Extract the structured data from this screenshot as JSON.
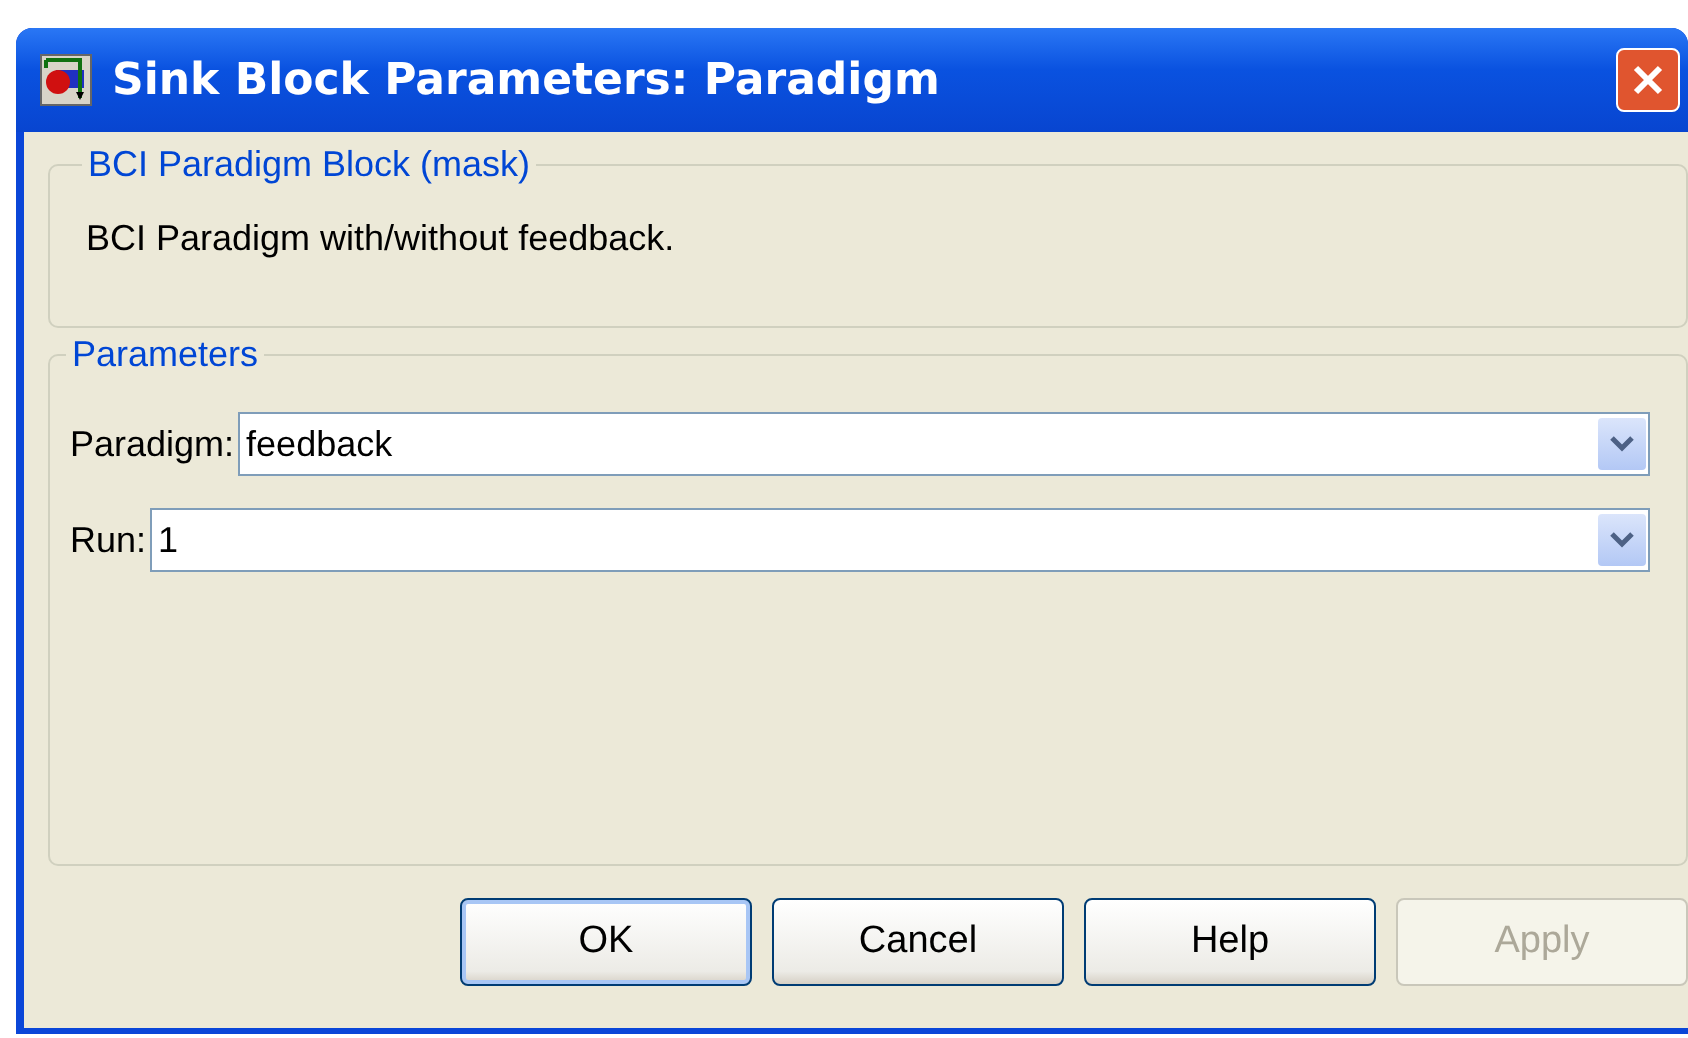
{
  "window": {
    "title": "Sink Block Parameters: Paradigm"
  },
  "description_group": {
    "legend": "BCI Paradigm Block (mask)",
    "text": "BCI Paradigm with/without feedback."
  },
  "parameters_group": {
    "legend": "Parameters",
    "fields": [
      {
        "label": "Paradigm:",
        "value": "feedback"
      },
      {
        "label": "Run:",
        "value": "1"
      }
    ]
  },
  "buttons": [
    {
      "label": "OK",
      "disabled": false,
      "default": true
    },
    {
      "label": "Cancel",
      "disabled": false,
      "default": false
    },
    {
      "label": "Help",
      "disabled": false,
      "default": false
    },
    {
      "label": "Apply",
      "disabled": true,
      "default": false
    }
  ]
}
